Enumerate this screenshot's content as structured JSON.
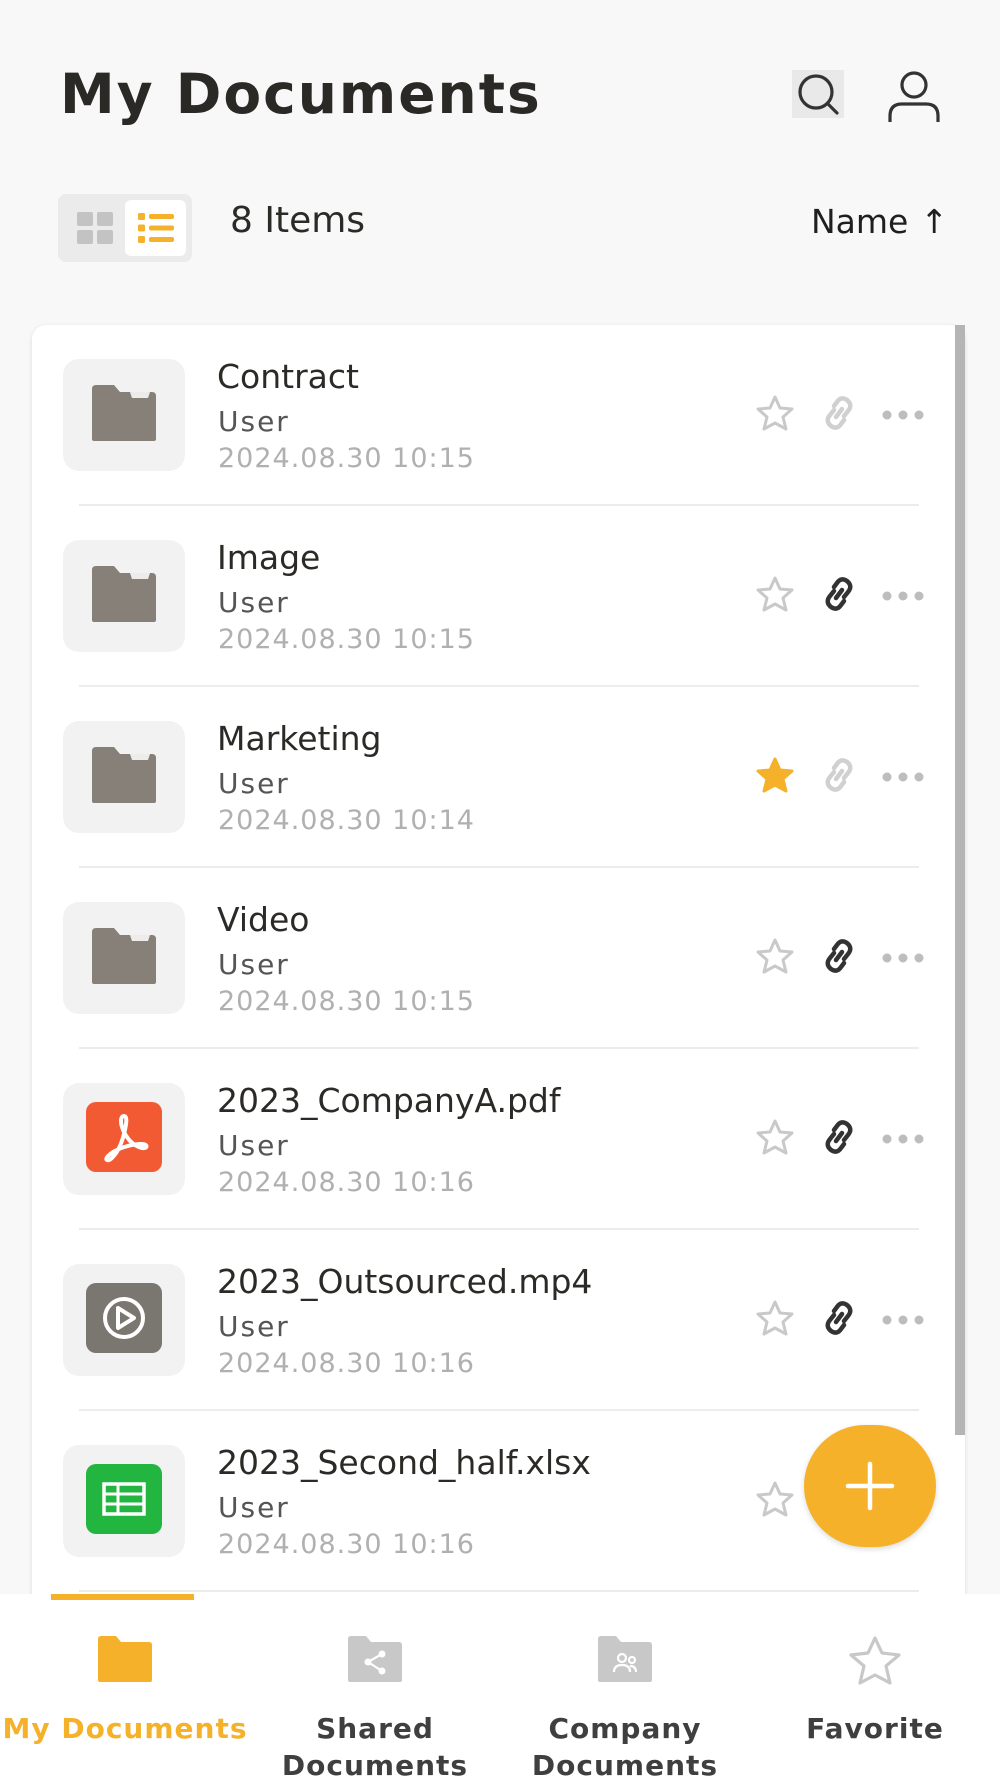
{
  "header": {
    "title": "My Documents",
    "search_icon": "search-icon",
    "profile_icon": "person-icon"
  },
  "toolbar": {
    "item_count": "8 Items",
    "sort_label": "Name",
    "sort_arrow": "↑",
    "view_modes": [
      "grid",
      "list"
    ],
    "active_view": "list"
  },
  "colors": {
    "accent": "#f6b12b",
    "folder": "#878078",
    "pdf": "#f15a32",
    "video": "#7a7670",
    "sheet": "#22b53f"
  },
  "items": [
    {
      "name": "Contract",
      "owner": "User",
      "date": "2024.08.30 10:15",
      "type": "folder",
      "starred": false,
      "linked": false
    },
    {
      "name": "Image",
      "owner": "User",
      "date": "2024.08.30 10:15",
      "type": "folder",
      "starred": false,
      "linked": true
    },
    {
      "name": "Marketing",
      "owner": "User",
      "date": "2024.08.30 10:14",
      "type": "folder",
      "starred": true,
      "linked": false
    },
    {
      "name": "Video",
      "owner": "User",
      "date": "2024.08.30 10:15",
      "type": "folder",
      "starred": false,
      "linked": true
    },
    {
      "name": "2023_CompanyA.pdf",
      "owner": "User",
      "date": "2024.08.30 10:16",
      "type": "pdf",
      "starred": false,
      "linked": true
    },
    {
      "name": "2023_Outsourced.mp4",
      "owner": "User",
      "date": "2024.08.30 10:16",
      "type": "video",
      "starred": false,
      "linked": true
    },
    {
      "name": "2023_Second_half.xlsx",
      "owner": "User",
      "date": "2024.08.30 10:16",
      "type": "sheet",
      "starred": false,
      "linked": true
    }
  ],
  "fab": {
    "icon": "plus-icon"
  },
  "bottom_nav": [
    {
      "label": "My Documents",
      "icon": "folder-icon",
      "active": true
    },
    {
      "label": "Shared Documents",
      "icon": "shared-folder-icon",
      "active": false
    },
    {
      "label": "Company Documents",
      "icon": "company-folder-icon",
      "active": false
    },
    {
      "label": "Favorite",
      "icon": "star-icon",
      "active": false
    }
  ]
}
